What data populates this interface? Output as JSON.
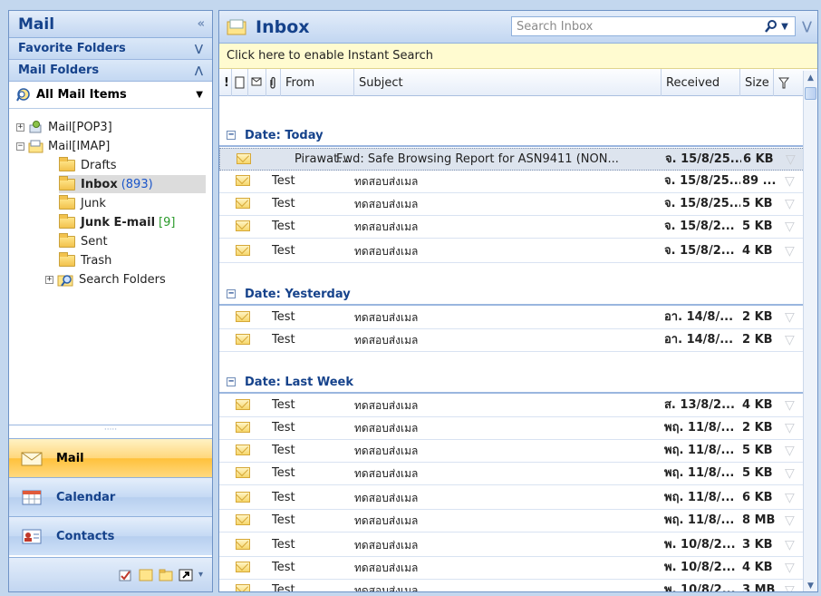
{
  "nav": {
    "title": "Mail",
    "collapse": "«",
    "favorite_folders": "Favorite Folders",
    "mail_folders": "Mail Folders",
    "all_mail_items": "All Mail Items",
    "tree": {
      "pop3": "Mail[POP3]",
      "imap": "Mail[IMAP]",
      "drafts": "Drafts",
      "inbox": "Inbox",
      "inbox_count": "(893)",
      "junk": "Junk",
      "junk_email": "Junk E-mail",
      "junk_email_count": "[9]",
      "sent": "Sent",
      "trash": "Trash",
      "search_folders": "Search Folders"
    },
    "buttons": {
      "mail": "Mail",
      "calendar": "Calendar",
      "contacts": "Contacts"
    }
  },
  "main": {
    "title": "Inbox",
    "search_placeholder": "Search Inbox",
    "instant_search": "Click here to enable Instant Search",
    "columns": {
      "importance": "!",
      "icon": "",
      "attach": "",
      "from": "From",
      "subject": "Subject",
      "received": "Received",
      "size": "Size"
    },
    "groups": {
      "today": "Date: Today",
      "yesterday": "Date: Yesterday",
      "last_week": "Date: Last Week"
    },
    "messages": [
      {
        "from": "Pirawat...",
        "subject": "Fwd: Safe Browsing Report for ASN9411 (NON...",
        "received": "จ. 15/8/25...",
        "size": "6 KB"
      },
      {
        "from": "Test",
        "subject": "ทดสอบส่งเมล",
        "received": "จ. 15/8/25...",
        "size": "89 ..."
      },
      {
        "from": "Test",
        "subject": "ทดสอบส่งเมล",
        "received": "จ. 15/8/25...",
        "size": "5 KB"
      },
      {
        "from": "Test",
        "subject": "ทดสอบส่งเมล",
        "received": "จ. 15/8/2...",
        "size": "5 KB"
      },
      {
        "from": "Test",
        "subject": "ทดสอบส่งเมล",
        "received": "จ. 15/8/2...",
        "size": "4 KB"
      },
      {
        "from": "Test",
        "subject": "ทดสอบส่งเมล",
        "received": "อา. 14/8/...",
        "size": "2 KB"
      },
      {
        "from": "Test",
        "subject": "ทดสอบส่งเมล",
        "received": "อา. 14/8/...",
        "size": "2 KB"
      },
      {
        "from": "Test",
        "subject": "ทดสอบส่งเมล",
        "received": "ส. 13/8/2...",
        "size": "4 KB"
      },
      {
        "from": "Test",
        "subject": "ทดสอบส่งเมล",
        "received": "พฤ. 11/8/...",
        "size": "2 KB"
      },
      {
        "from": "Test",
        "subject": "ทดสอบส่งเมล",
        "received": "พฤ. 11/8/...",
        "size": "5 KB"
      },
      {
        "from": "Test",
        "subject": "ทดสอบส่งเมล",
        "received": "พฤ. 11/8/...",
        "size": "5 KB"
      },
      {
        "from": "Test",
        "subject": "ทดสอบส่งเมล",
        "received": "พฤ. 11/8/...",
        "size": "6 KB"
      },
      {
        "from": "Test",
        "subject": "ทดสอบส่งเมล",
        "received": "พฤ. 11/8/...",
        "size": "8 MB"
      },
      {
        "from": "Test",
        "subject": "ทดสอบส่งเมล",
        "received": "พ. 10/8/2...",
        "size": "3 KB"
      },
      {
        "from": "Test",
        "subject": "ทดสอบส่งเมล",
        "received": "พ. 10/8/2...",
        "size": "4 KB"
      },
      {
        "from": "Test",
        "subject": "ทดสอบส่งเมล",
        "received": "พ. 10/8/2...",
        "size": "3 MB"
      }
    ]
  },
  "colors": {
    "header_text": "#15428b",
    "count_blue": "#1a55c9",
    "count_green": "#2a9a2a",
    "active_nav": "#ffc13b",
    "instant_bar": "#fffbd0"
  }
}
